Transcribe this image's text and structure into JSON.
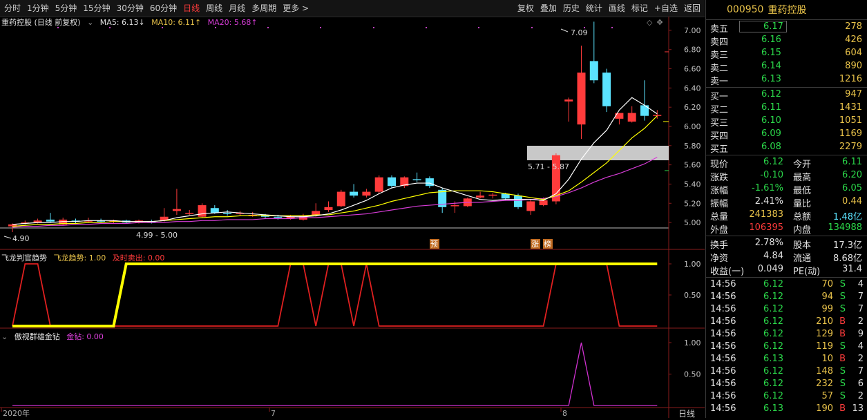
{
  "toolbar": {
    "periods": [
      "分时",
      "1分钟",
      "5分钟",
      "15分钟",
      "30分钟",
      "60分钟",
      "日线",
      "周线",
      "月线",
      "多周期",
      "更多 >"
    ],
    "active_period": "日线",
    "actions": [
      "复权",
      "叠加",
      "历史",
      "统计",
      "画线",
      "标记",
      "+自选",
      "返回"
    ]
  },
  "main_chart": {
    "title": "重药控股 (日线 前复权)",
    "ma5_label": "MA5: 6.13↓",
    "ma10_label": "MA10: 6.11↑",
    "ma20_label": "MA20: 5.68↑",
    "high_label": "7.09",
    "low_label": "4.90",
    "range_label_low": "4.99 - 5.00",
    "range_label_mid": "5.71 - 5.87",
    "y_ticks": [
      "7.00",
      "6.80",
      "6.60",
      "6.40",
      "6.20",
      "6.00",
      "5.80",
      "5.60",
      "5.40",
      "5.20",
      "5.00"
    ],
    "markers": [
      "预",
      "涨",
      "榜"
    ],
    "colors": {
      "up": "#ff3b3b",
      "down": "#5be3ff",
      "ma5": "#ffffff",
      "ma10": "#ffff00",
      "ma20": "#d63cd6"
    }
  },
  "indicator1": {
    "name": "飞龙判官趋势",
    "trend_label": "飞龙趋势: 1.00",
    "sell_label": "及时卖出: 0.00",
    "y_ticks": [
      "1.00",
      "0.50"
    ]
  },
  "indicator2": {
    "name": "傲视群雄金钻",
    "value_label": "金钻: 0.00",
    "y_ticks": [
      "1.00",
      "0.50"
    ]
  },
  "x_axis": {
    "labels": [
      "2020年",
      "7",
      "8"
    ],
    "period_label": "日线"
  },
  "chart_data": {
    "type": "candlestick",
    "candles": [
      [
        4.96,
        4.98,
        4.99,
        4.9
      ],
      [
        5.0,
        5.0,
        5.02,
        4.98
      ],
      [
        5.0,
        5.02,
        5.04,
        4.99
      ],
      [
        5.03,
        5.01,
        5.1,
        5.0
      ],
      [
        4.98,
        5.03,
        5.05,
        4.97
      ],
      [
        5.02,
        5.01,
        5.04,
        4.99
      ],
      [
        5.01,
        5.02,
        5.05,
        5.0
      ],
      [
        5.02,
        5.01,
        5.04,
        5.0
      ],
      [
        5.01,
        5.02,
        5.03,
        4.99
      ],
      [
        5.02,
        5.0,
        5.03,
        4.99
      ],
      [
        5.0,
        5.02,
        5.03,
        4.99
      ],
      [
        5.01,
        5.0,
        5.03,
        4.99
      ],
      [
        5.02,
        5.06,
        5.15,
        5.01
      ],
      [
        5.12,
        5.14,
        5.35,
        5.08
      ],
      [
        5.1,
        5.1,
        5.13,
        5.08
      ],
      [
        5.06,
        5.18,
        5.2,
        5.05
      ],
      [
        5.15,
        5.1,
        5.18,
        5.09
      ],
      [
        5.1,
        5.09,
        5.13,
        5.07
      ],
      [
        5.09,
        5.1,
        5.12,
        5.07
      ],
      [
        5.08,
        5.08,
        5.11,
        5.06
      ],
      [
        5.08,
        5.06,
        5.09,
        5.04
      ],
      [
        5.06,
        5.05,
        5.08,
        5.03
      ],
      [
        5.04,
        5.06,
        5.08,
        5.03
      ],
      [
        5.03,
        5.07,
        5.09,
        5.02
      ],
      [
        5.08,
        5.12,
        5.2,
        5.06
      ],
      [
        5.13,
        5.16,
        5.22,
        5.11
      ],
      [
        5.17,
        5.32,
        5.34,
        5.16
      ],
      [
        5.32,
        5.28,
        5.4,
        5.26
      ],
      [
        5.28,
        5.32,
        5.35,
        5.26
      ],
      [
        5.32,
        5.47,
        5.49,
        5.3
      ],
      [
        5.47,
        5.38,
        5.49,
        5.36
      ],
      [
        5.38,
        5.47,
        5.48,
        5.36
      ],
      [
        5.45,
        5.44,
        5.52,
        5.42
      ],
      [
        5.46,
        5.38,
        5.48,
        5.36
      ],
      [
        5.34,
        5.16,
        5.36,
        5.1
      ],
      [
        5.18,
        5.18,
        5.22,
        5.1
      ],
      [
        5.17,
        5.25,
        5.26,
        5.16
      ],
      [
        5.26,
        5.28,
        5.32,
        5.25
      ],
      [
        5.28,
        5.29,
        5.31,
        5.25
      ],
      [
        5.3,
        5.25,
        5.31,
        5.23
      ],
      [
        5.28,
        5.16,
        5.3,
        5.14
      ],
      [
        5.12,
        5.22,
        5.24,
        5.08
      ],
      [
        5.18,
        5.23,
        5.26,
        5.17
      ],
      [
        5.22,
        5.7,
        5.72,
        5.19
      ],
      [
        6.26,
        6.28,
        6.3,
        6.05
      ],
      [
        6.02,
        6.56,
        6.84,
        5.87
      ],
      [
        6.68,
        6.48,
        7.09,
        6.45
      ],
      [
        6.56,
        6.21,
        6.6,
        6.15
      ],
      [
        6.08,
        6.14,
        6.14,
        6.02
      ],
      [
        6.05,
        6.14,
        6.21,
        6.04
      ],
      [
        6.22,
        6.11,
        6.48,
        6.06
      ],
      [
        6.12,
        6.12,
        6.17,
        6.08
      ]
    ],
    "ma5": [
      4.98,
      4.99,
      5.0,
      5.0,
      5.01,
      5.01,
      5.02,
      5.02,
      5.02,
      5.01,
      5.01,
      5.01,
      5.02,
      5.05,
      5.07,
      5.09,
      5.1,
      5.11,
      5.1,
      5.09,
      5.08,
      5.07,
      5.06,
      5.06,
      5.07,
      5.09,
      5.13,
      5.18,
      5.23,
      5.3,
      5.36,
      5.39,
      5.41,
      5.41,
      5.36,
      5.32,
      5.28,
      5.24,
      5.23,
      5.24,
      5.24,
      5.24,
      5.23,
      5.3,
      5.45,
      5.66,
      5.83,
      5.96,
      6.17,
      6.3,
      6.22,
      6.13
    ],
    "ma10": [
      4.96,
      4.97,
      4.98,
      4.98,
      4.99,
      4.99,
      5.0,
      5.0,
      5.01,
      5.01,
      5.01,
      5.01,
      5.02,
      5.03,
      5.04,
      5.05,
      5.06,
      5.06,
      5.07,
      5.07,
      5.07,
      5.07,
      5.07,
      5.07,
      5.08,
      5.08,
      5.1,
      5.12,
      5.15,
      5.18,
      5.22,
      5.25,
      5.28,
      5.31,
      5.32,
      5.33,
      5.33,
      5.33,
      5.32,
      5.3,
      5.28,
      5.26,
      5.24,
      5.28,
      5.33,
      5.42,
      5.52,
      5.62,
      5.75,
      5.88,
      5.98,
      6.11
    ],
    "ma20": [
      4.95,
      4.96,
      4.96,
      4.97,
      4.97,
      4.98,
      4.98,
      4.99,
      4.99,
      4.99,
      5.0,
      5.0,
      5.0,
      5.01,
      5.01,
      5.02,
      5.02,
      5.03,
      5.03,
      5.03,
      5.04,
      5.04,
      5.04,
      5.05,
      5.05,
      5.06,
      5.07,
      5.08,
      5.09,
      5.11,
      5.13,
      5.15,
      5.17,
      5.18,
      5.19,
      5.2,
      5.21,
      5.21,
      5.22,
      5.23,
      5.23,
      5.24,
      5.25,
      5.27,
      5.31,
      5.36,
      5.42,
      5.47,
      5.51,
      5.56,
      5.61,
      5.68
    ],
    "trend": [
      0,
      0,
      0,
      0,
      0,
      0,
      0,
      0,
      0,
      1,
      1,
      1,
      1,
      1,
      1,
      1,
      1,
      1,
      1,
      1,
      1,
      1,
      1,
      1,
      1,
      1,
      1,
      1,
      1,
      1,
      1,
      1,
      1,
      1,
      1,
      1,
      1,
      1,
      1,
      1,
      1,
      1,
      1,
      1,
      1,
      1,
      1,
      1,
      1,
      1,
      1,
      1
    ],
    "sell": [
      0,
      1,
      1,
      0,
      0,
      0,
      0,
      0,
      0,
      0,
      0,
      0,
      0,
      0,
      0,
      0,
      0,
      0,
      0,
      0,
      0,
      0,
      1,
      1,
      0,
      1,
      1,
      0,
      1,
      0,
      0,
      0,
      0,
      0,
      0,
      0,
      0,
      0,
      0,
      0,
      0,
      0,
      0,
      1,
      1,
      1,
      1,
      1,
      0,
      0,
      0,
      0
    ],
    "gold": [
      0,
      0,
      0,
      0,
      0,
      0,
      0,
      0,
      0,
      0,
      0,
      0,
      0,
      0,
      0,
      0,
      0,
      0,
      0,
      0,
      0,
      0,
      0,
      0,
      0,
      0,
      0,
      0,
      0,
      0,
      0,
      0,
      0,
      0,
      0,
      0,
      0,
      0,
      0,
      0,
      0,
      0,
      0,
      0,
      0,
      1,
      0,
      0,
      0,
      0,
      0,
      0
    ],
    "ylim": [
      4.9,
      7.1
    ]
  },
  "quote": {
    "code": "000950",
    "name": "重药控股",
    "sell": [
      {
        "label": "卖五",
        "price": "6.17",
        "vol": "278"
      },
      {
        "label": "卖四",
        "price": "6.16",
        "vol": "426"
      },
      {
        "label": "卖三",
        "price": "6.15",
        "vol": "604"
      },
      {
        "label": "卖二",
        "price": "6.14",
        "vol": "890"
      },
      {
        "label": "卖一",
        "price": "6.13",
        "vol": "1216"
      }
    ],
    "buy": [
      {
        "label": "买一",
        "price": "6.12",
        "vol": "947"
      },
      {
        "label": "买二",
        "price": "6.11",
        "vol": "1431"
      },
      {
        "label": "买三",
        "price": "6.10",
        "vol": "1051"
      },
      {
        "label": "买四",
        "price": "6.09",
        "vol": "1169"
      },
      {
        "label": "买五",
        "price": "6.08",
        "vol": "2279"
      }
    ],
    "stats": [
      {
        "l1": "现价",
        "v1": "6.12",
        "c1": "green",
        "l2": "今开",
        "v2": "6.11",
        "c2": "green"
      },
      {
        "l1": "涨跌",
        "v1": "-0.10",
        "c1": "green",
        "l2": "最高",
        "v2": "6.20",
        "c2": "green"
      },
      {
        "l1": "涨幅",
        "v1": "-1.61%",
        "c1": "green",
        "l2": "最低",
        "v2": "6.05",
        "c2": "green"
      },
      {
        "l1": "振幅",
        "v1": "2.41%",
        "c1": "white",
        "l2": "量比",
        "v2": "0.44",
        "c2": "yellow"
      },
      {
        "l1": "总量",
        "v1": "241383",
        "c1": "yellow",
        "l2": "总额",
        "v2": "1.48亿",
        "c2": "cyan"
      },
      {
        "l1": "外盘",
        "v1": "106395",
        "c1": "red",
        "l2": "内盘",
        "v2": "134988",
        "c2": "green"
      }
    ],
    "fund": [
      {
        "l1": "换手",
        "v1": "2.78%",
        "l2": "股本",
        "v2": "17.3亿"
      },
      {
        "l1": "净资",
        "v1": "4.84",
        "l2": "流通",
        "v2": "8.68亿"
      },
      {
        "l1": "收益(一)",
        "v1": "0.049",
        "l2": "PE(动)",
        "v2": "31.4"
      }
    ],
    "ticks": [
      {
        "t": "14:56",
        "p": "6.12",
        "v": "70",
        "s": "S",
        "n": "4"
      },
      {
        "t": "14:56",
        "p": "6.12",
        "v": "94",
        "s": "S",
        "n": "7"
      },
      {
        "t": "14:56",
        "p": "6.12",
        "v": "99",
        "s": "S",
        "n": "7"
      },
      {
        "t": "14:56",
        "p": "6.12",
        "v": "210",
        "s": "B",
        "n": "2"
      },
      {
        "t": "14:56",
        "p": "6.12",
        "v": "129",
        "s": "B",
        "n": "9"
      },
      {
        "t": "14:56",
        "p": "6.12",
        "v": "119",
        "s": "S",
        "n": "4"
      },
      {
        "t": "14:56",
        "p": "6.13",
        "v": "10",
        "s": "B",
        "n": "2"
      },
      {
        "t": "14:56",
        "p": "6.12",
        "v": "148",
        "s": "S",
        "n": "7"
      },
      {
        "t": "14:56",
        "p": "6.12",
        "v": "232",
        "s": "S",
        "n": "6"
      },
      {
        "t": "14:56",
        "p": "6.12",
        "v": "57",
        "s": "S",
        "n": "2"
      },
      {
        "t": "14:56",
        "p": "6.13",
        "v": "190",
        "s": "B",
        "n": "13"
      }
    ]
  }
}
